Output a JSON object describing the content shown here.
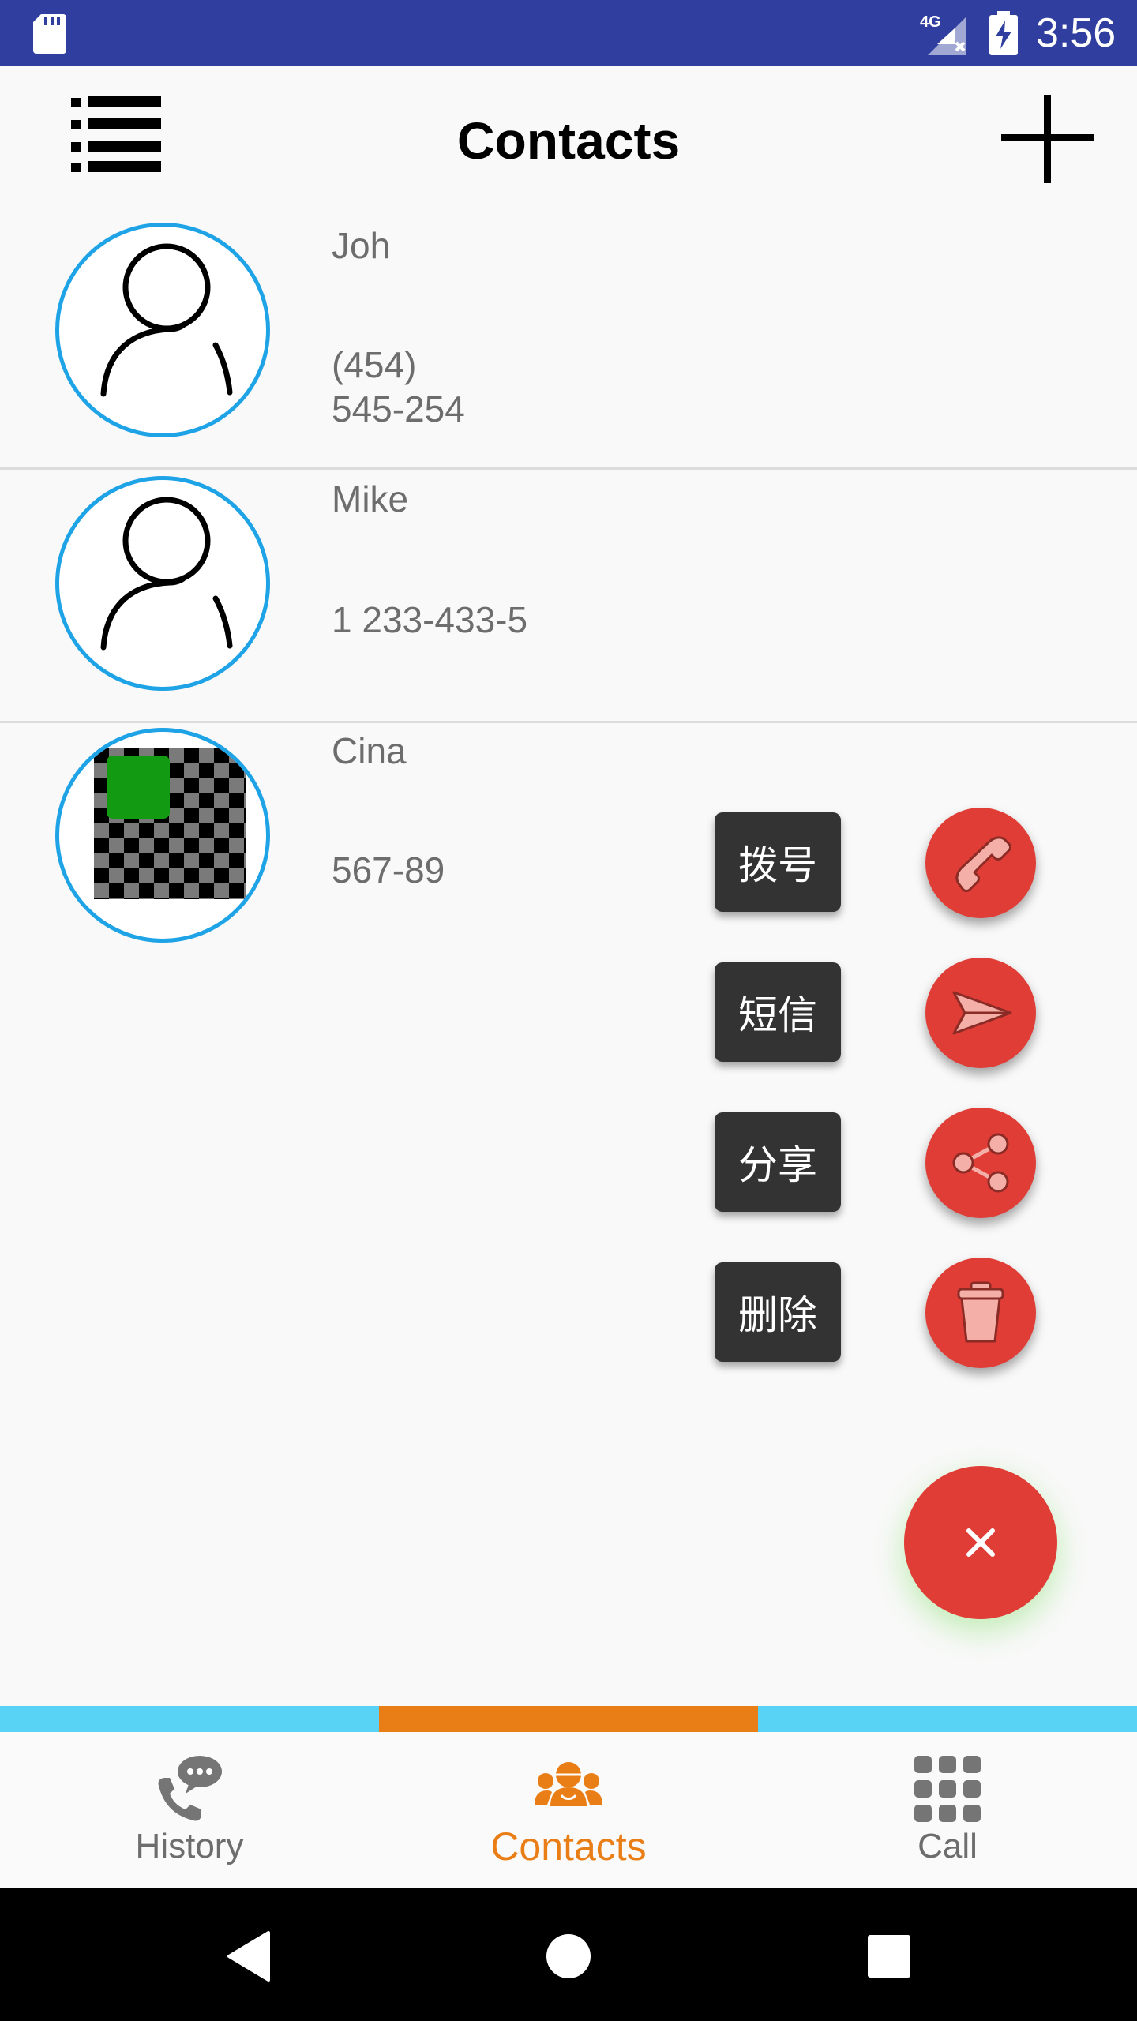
{
  "status_bar": {
    "time": "3:56",
    "network": "4G"
  },
  "app_bar": {
    "title": "Contacts"
  },
  "contacts": [
    {
      "name": "Joh",
      "phone": "(454)\n545-254",
      "avatar": "person-outline-icon"
    },
    {
      "name": "Mike",
      "phone": "1 233-433-5",
      "avatar": "person-outline-icon"
    },
    {
      "name": "Cina",
      "phone": "567-89",
      "avatar": "checkerboard-photo"
    }
  ],
  "speed_dial": {
    "actions": [
      {
        "label": "拨号",
        "icon": "phone-icon"
      },
      {
        "label": "短信",
        "icon": "send-icon"
      },
      {
        "label": "分享",
        "icon": "share-icon"
      },
      {
        "label": "删除",
        "icon": "trash-icon"
      }
    ],
    "main_icon": "close-icon",
    "accent": "#e03d36"
  },
  "bottom_tabs": {
    "items": [
      {
        "label": "History",
        "icon": "phone-chat-icon"
      },
      {
        "label": "Contacts",
        "icon": "group-icon",
        "active": true
      },
      {
        "label": "Call",
        "icon": "dialpad-icon"
      }
    ],
    "indicator_color": "#58d2f5",
    "active_color": "#ea7e16"
  },
  "colors": {
    "status_bar": "#303f9f",
    "avatar_ring": "#1ea3e6"
  }
}
